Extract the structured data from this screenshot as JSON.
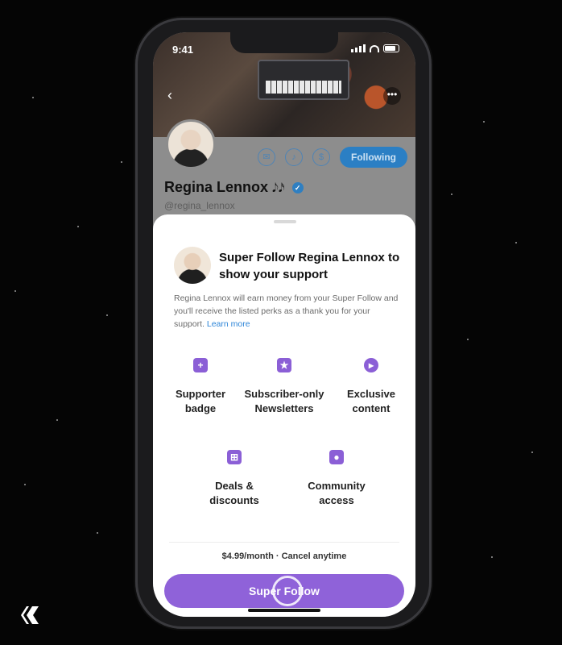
{
  "status_bar": {
    "time": "9:41"
  },
  "profile": {
    "name": "Regina Lennox",
    "name_emoji": "𝅘𝅥𝅮𝅘𝅥𝅯",
    "handle": "@regina_lennox",
    "following_label": "Following",
    "icons": [
      "back-icon",
      "more-icon",
      "mail-icon",
      "bell-icon",
      "dollar-icon",
      "verified-badge-icon"
    ]
  },
  "sheet": {
    "title": "Super Follow Regina Lennox to show your support",
    "description": "Regina Lennox will earn money from your Super Follow and you'll receive the listed perks as a thank you for your support.",
    "learn_more": "Learn more",
    "perks": [
      {
        "label": "Supporter badge",
        "icon": "badge-icon"
      },
      {
        "label": "Subscriber-only Newsletters",
        "icon": "bookmark-icon"
      },
      {
        "label": "Exclusive content",
        "icon": "play-icon"
      },
      {
        "label": "Deals & discounts",
        "icon": "cart-icon"
      },
      {
        "label": "Community access",
        "icon": "community-icon"
      }
    ],
    "price": "$4.99/month · Cancel anytime",
    "cta_label": "Super Follow"
  },
  "colors": {
    "accent_purple": "#8f62d9",
    "following_blue": "#2b7fc4",
    "background": "#050505"
  }
}
